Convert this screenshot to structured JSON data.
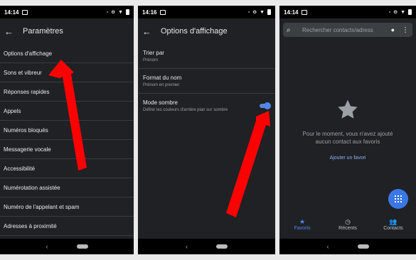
{
  "screens": {
    "settings": {
      "status_time": "14:14",
      "title": "Paramètres",
      "items": [
        "Options d'affichage",
        "Sons et vibreur",
        "Réponses rapides",
        "Appels",
        "Numéros bloqués",
        "Messagerie vocale",
        "Accessibilité",
        "Numérotation assistée",
        "Numéro de l'appelant et spam",
        "Adresses à proximité"
      ]
    },
    "display": {
      "status_time": "14:16",
      "title": "Options d'affichage",
      "sort_title": "Trier par",
      "sort_value": "Prénom",
      "format_title": "Format du nom",
      "format_value": "Prénom en premier",
      "dark_title": "Mode sombre",
      "dark_desc": "Définir les couleurs d'arrière plan sur sombre",
      "dark_enabled": true
    },
    "contacts": {
      "status_time": "14:14",
      "search_placeholder": "Rechercher contacts/adress",
      "empty_line1": "Pour le moment, vous n'avez ajouté",
      "empty_line2": "aucun contact aux favoris",
      "add_favorite": "Ajouter un favori",
      "tabs": [
        "Favoris",
        "Récents",
        "Contacts"
      ],
      "active_tab": "Favoris"
    }
  },
  "colors": {
    "background": "#202124",
    "accent": "#4f86f2",
    "arrow": "#ff0000"
  }
}
